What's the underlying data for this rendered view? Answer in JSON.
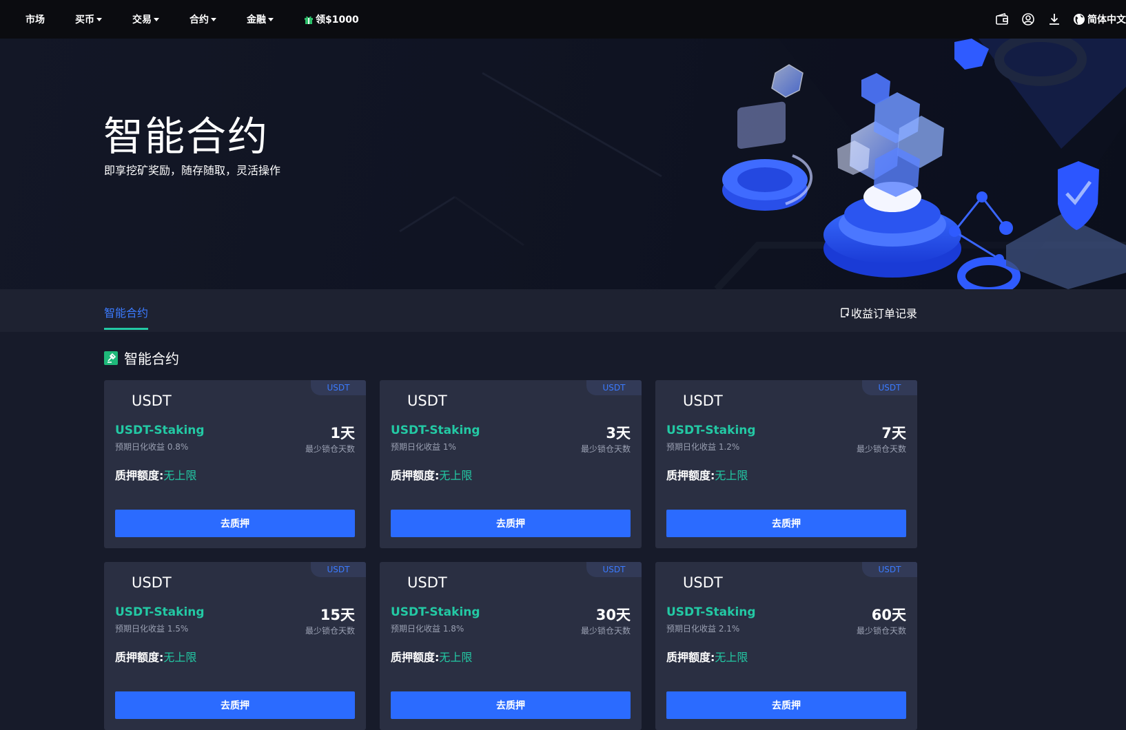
{
  "nav": {
    "items": [
      {
        "label": "市场",
        "dropdown": false
      },
      {
        "label": "买币",
        "dropdown": true
      },
      {
        "label": "交易",
        "dropdown": true
      },
      {
        "label": "合约",
        "dropdown": true
      },
      {
        "label": "金融",
        "dropdown": true
      }
    ],
    "promo_label": "领$1000",
    "language_label": "简体中文",
    "icons": [
      "wallet-icon",
      "user-icon",
      "download-icon",
      "globe-icon"
    ]
  },
  "hero": {
    "title": "智能合约",
    "subtitle": "即享挖矿奖励，随存随取，灵活操作"
  },
  "tabs": {
    "active_label": "智能合约",
    "records_label": "收益订单记录"
  },
  "section": {
    "title": "智能合约"
  },
  "cards": [
    {
      "badge": "USDT",
      "coin": "USDT",
      "name": "USDT-Staking",
      "yield": "预期日化收益 0.8%",
      "days": "1天",
      "days_label": "最少锁仓天数",
      "quota_label": "质押额度:",
      "quota_value": "无上限",
      "button": "去质押"
    },
    {
      "badge": "USDT",
      "coin": "USDT",
      "name": "USDT-Staking",
      "yield": "预期日化收益 1%",
      "days": "3天",
      "days_label": "最少锁仓天数",
      "quota_label": "质押额度:",
      "quota_value": "无上限",
      "button": "去质押"
    },
    {
      "badge": "USDT",
      "coin": "USDT",
      "name": "USDT-Staking",
      "yield": "预期日化收益 1.2%",
      "days": "7天",
      "days_label": "最少锁仓天数",
      "quota_label": "质押额度:",
      "quota_value": "无上限",
      "button": "去质押"
    },
    {
      "badge": "USDT",
      "coin": "USDT",
      "name": "USDT-Staking",
      "yield": "预期日化收益 1.5%",
      "days": "15天",
      "days_label": "最少锁仓天数",
      "quota_label": "质押额度:",
      "quota_value": "无上限",
      "button": "去质押"
    },
    {
      "badge": "USDT",
      "coin": "USDT",
      "name": "USDT-Staking",
      "yield": "预期日化收益 1.8%",
      "days": "30天",
      "days_label": "最少锁仓天数",
      "quota_label": "质押额度:",
      "quota_value": "无上限",
      "button": "去质押"
    },
    {
      "badge": "USDT",
      "coin": "USDT",
      "name": "USDT-Staking",
      "yield": "预期日化收益 2.1%",
      "days": "60天",
      "days_label": "最少锁仓天数",
      "quota_label": "质押额度:",
      "quota_value": "无上限",
      "button": "去质押"
    }
  ],
  "colors": {
    "accent_blue": "#2b6bff",
    "accent_green": "#23c9a4",
    "card_bg": "#2a2f42",
    "page_bg": "#171b2a"
  }
}
